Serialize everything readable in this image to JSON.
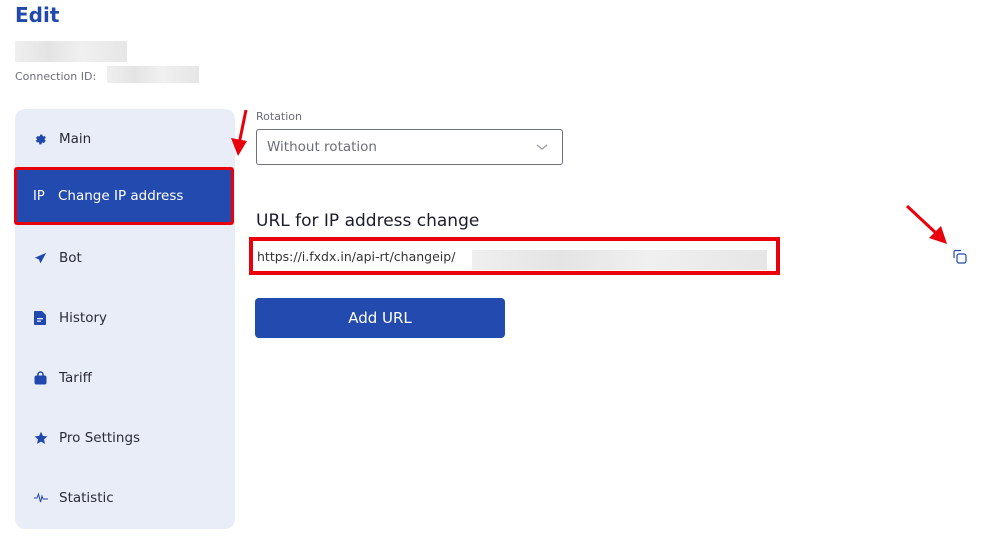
{
  "header": {
    "title": "Edit",
    "connection_label": "Connection ID:"
  },
  "sidebar": {
    "items": [
      {
        "label": "Main",
        "icon": "gear-icon"
      },
      {
        "label": "Change IP address",
        "icon": "ip-icon",
        "icon_text": "IP",
        "active": true
      },
      {
        "label": "Bot",
        "icon": "paper-plane-icon"
      },
      {
        "label": "History",
        "icon": "document-icon"
      },
      {
        "label": "Tariff",
        "icon": "shopping-bag-icon"
      },
      {
        "label": "Pro Settings",
        "icon": "star-icon"
      },
      {
        "label": "Statistic",
        "icon": "pulse-icon"
      }
    ]
  },
  "rotation": {
    "label": "Rotation",
    "selected": "Without rotation"
  },
  "url_section": {
    "heading": "URL for IP address change",
    "url_prefix": "https://i.fxdx.in/api-rt/changeip/"
  },
  "buttons": {
    "add_url": "Add URL"
  },
  "colors": {
    "accent": "#234baf",
    "highlight": "#e8000b",
    "sidebar_bg": "#e9edf7"
  }
}
